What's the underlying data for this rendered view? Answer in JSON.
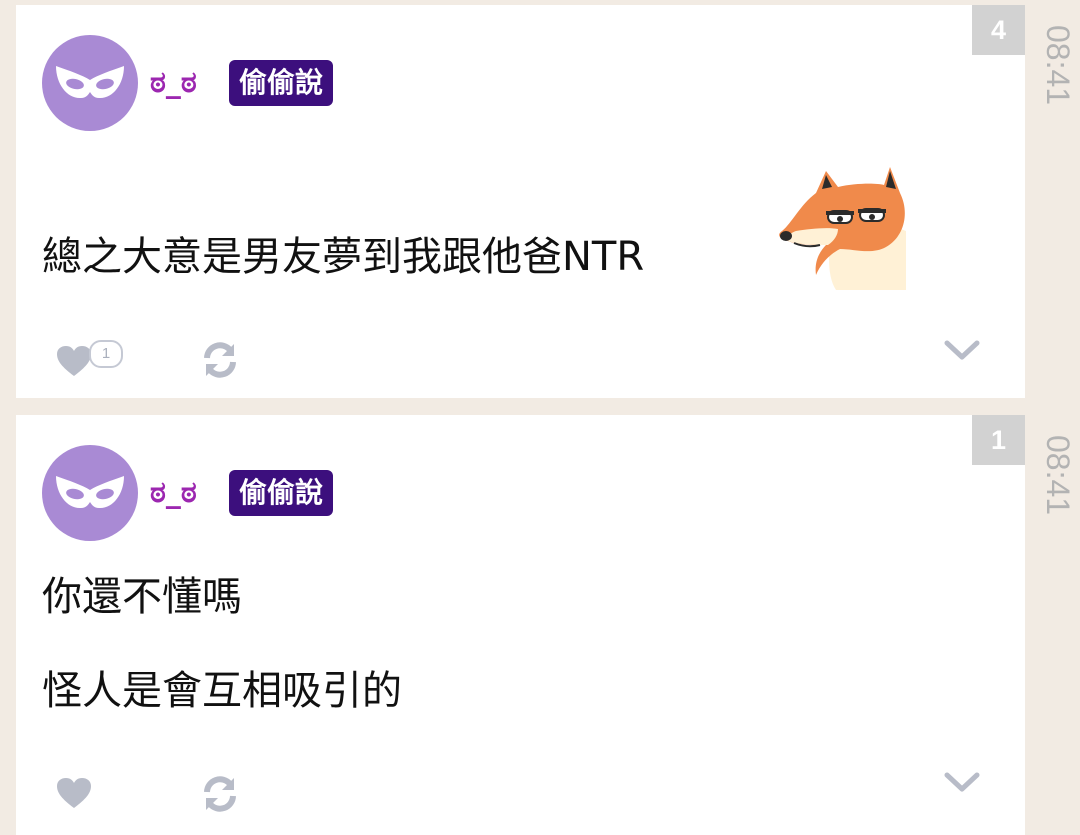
{
  "posts": [
    {
      "floor": "4",
      "time": "08:41",
      "author": {
        "name": "ಠ_ಠ",
        "tag": "偷偷說",
        "avatar_icon": "mask-icon",
        "avatar_color": "#a98ad4"
      },
      "content": [
        "總之大意是男友夢到我跟他爸NTR"
      ],
      "sticker": "fox-sticker",
      "likes": "1"
    },
    {
      "floor": "1",
      "time": "08:41",
      "author": {
        "name": "ಠ_ಠ",
        "tag": "偷偷說",
        "avatar_icon": "mask-icon",
        "avatar_color": "#a98ad4"
      },
      "content": [
        "你還不懂嗎",
        "怪人是會互相吸引的"
      ]
    }
  ],
  "icons": {
    "like": "heart-icon",
    "repost": "refresh-icon",
    "more": "chevron-down-icon"
  },
  "colors": {
    "background": "#f2ebe3",
    "tag_bg": "#3c0f7d",
    "username": "#9c27b0",
    "badge_bg": "#d2d2d2",
    "icon_gray": "#b8bcc8"
  }
}
